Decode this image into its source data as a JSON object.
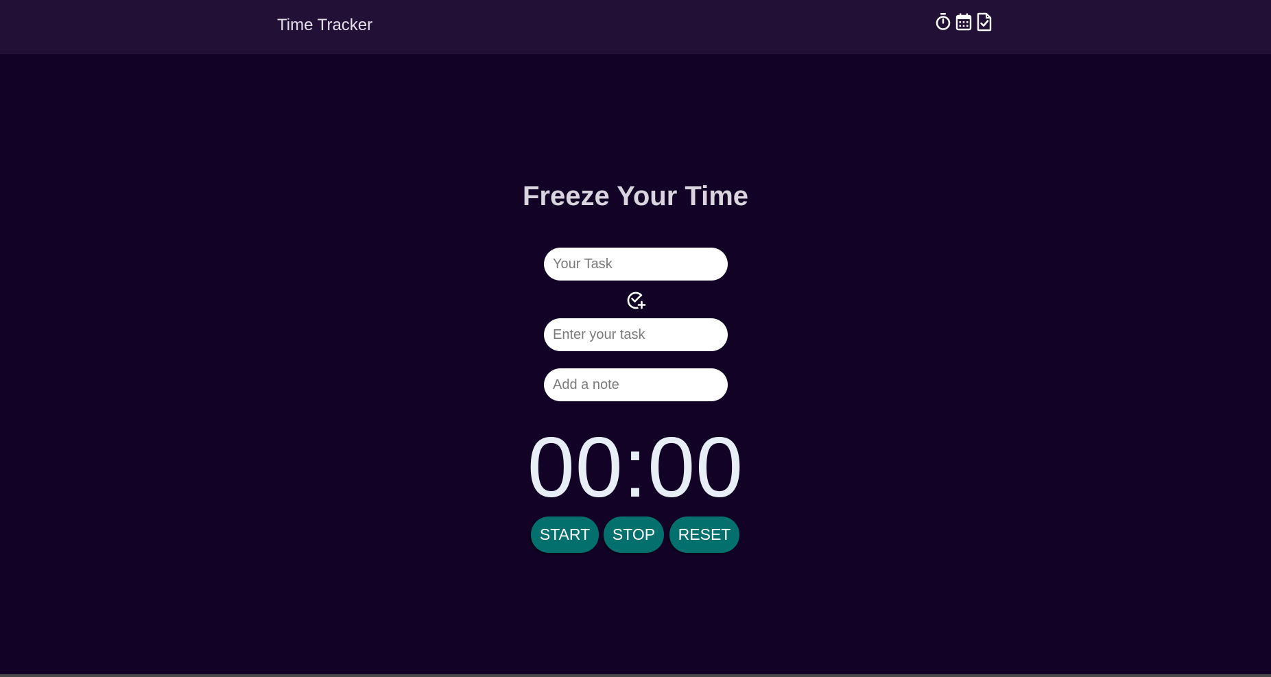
{
  "navbar": {
    "brand": "Time Tracker",
    "icons": [
      "stopwatch-icon",
      "calendar-icon",
      "document-check-icon"
    ]
  },
  "main": {
    "heading": "Freeze Your Time",
    "task_input_placeholder": "Your Task",
    "add_icon": "check-circle-plus-icon",
    "enter_task_placeholder": "Enter your task",
    "note_placeholder": "Add a note",
    "timer": "00:00",
    "buttons": {
      "start": "START",
      "stop": "STOP",
      "reset": "RESET"
    }
  },
  "colors": {
    "background": "#120326",
    "navbar": "#221036",
    "button": "#04706e"
  }
}
